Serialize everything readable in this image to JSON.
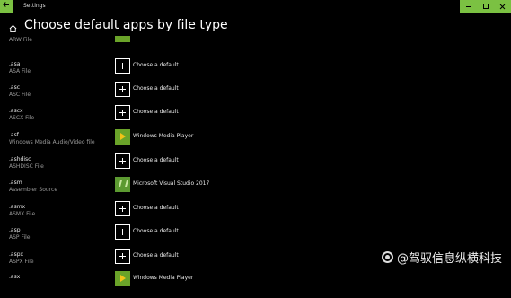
{
  "window": {
    "title": "Settings"
  },
  "header": {
    "title": "Choose default apps by file type"
  },
  "rows": [
    {
      "ext": "",
      "desc": "ARW File",
      "tile": "tile-top",
      "app": ""
    },
    {
      "ext": ".asa",
      "desc": "ASA File",
      "tile": "tile-plus",
      "app": "Choose a default"
    },
    {
      "ext": ".asc",
      "desc": "ASC File",
      "tile": "tile-plus",
      "app": "Choose a default"
    },
    {
      "ext": ".ascx",
      "desc": "ASCX File",
      "tile": "tile-plus",
      "app": "Choose a default"
    },
    {
      "ext": ".asf",
      "desc": "Windows Media Audio/Video file",
      "tile": "tile-wmp",
      "app": "Windows Media Player"
    },
    {
      "ext": ".ashdisc",
      "desc": "ASHDISC File",
      "tile": "tile-plus",
      "app": "Choose a default"
    },
    {
      "ext": ".asm",
      "desc": "Assembler Source",
      "tile": "tile-vs",
      "app": "Microsoft Visual Studio 2017"
    },
    {
      "ext": ".asmx",
      "desc": "ASMX File",
      "tile": "tile-plus",
      "app": "Choose a default"
    },
    {
      "ext": ".asp",
      "desc": "ASP File",
      "tile": "tile-plus",
      "app": "Choose a default"
    },
    {
      "ext": ".aspx",
      "desc": "ASPX File",
      "tile": "tile-plus",
      "app": "Choose a default"
    },
    {
      "ext": ".asx",
      "desc": "",
      "tile": "tile-wmp",
      "app": "Windows Media Player"
    }
  ],
  "watermark": {
    "text": "@驾驭信息纵横科技"
  },
  "colors": {
    "accent": "#7bc142",
    "background": "#000000",
    "text": "#ffffff",
    "secondary_text": "#9a9a9a"
  }
}
